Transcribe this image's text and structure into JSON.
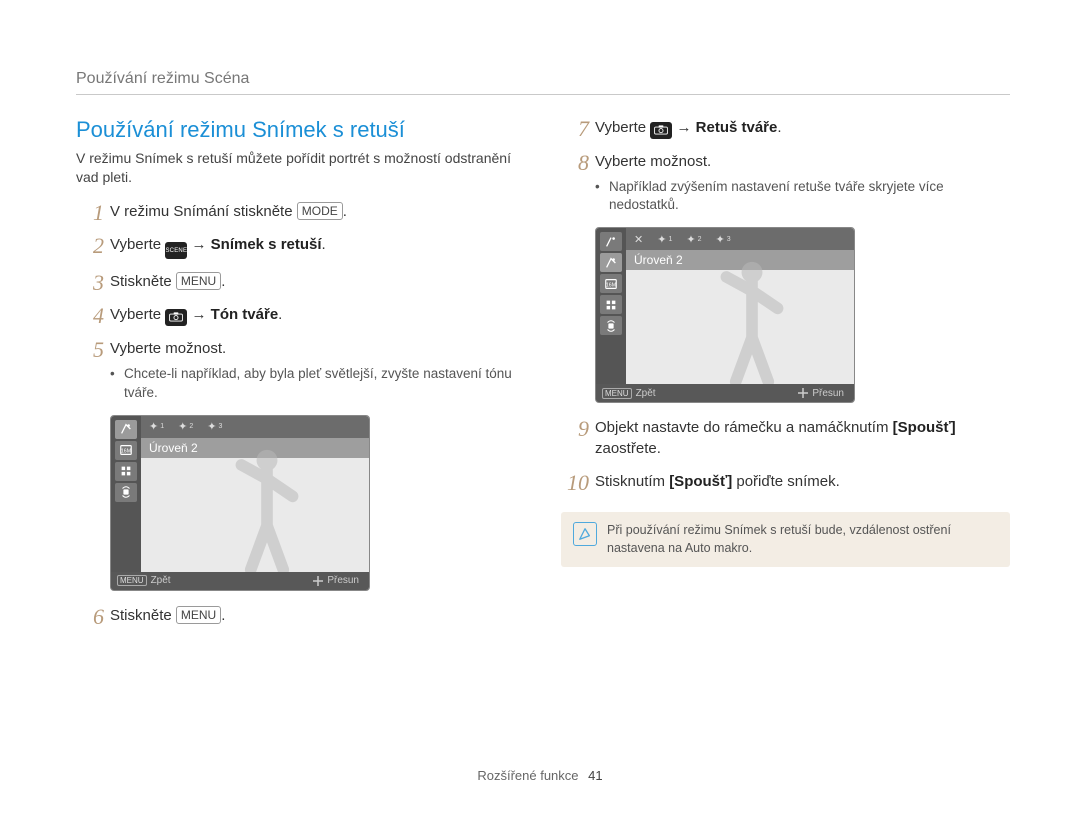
{
  "header": "Používání režimu Scéna",
  "title": "Používání režimu Snímek s retuší",
  "intro": "V režimu Snímek s retuší můžete pořídit portrét s možností odstranění vad pleti.",
  "tags": {
    "mode": "MODE",
    "menu": "MENU",
    "scene": "SCENE"
  },
  "left_steps": {
    "s1_a": "V režimu Snímání stiskněte ",
    "s1_b": ".",
    "s2_a": "Vyberte ",
    "s2_b": " → ",
    "s2_c": "Snímek s retuší",
    "s2_d": ".",
    "s3_a": "Stiskněte ",
    "s3_b": ".",
    "s4_a": "Vyberte ",
    "s4_b": " → ",
    "s4_c": "Tón tváře",
    "s4_d": ".",
    "s5": "Vyberte možnost.",
    "s5_sub": "Chcete-li například, aby byla pleť světlejší, zvyšte nastavení tónu tváře.",
    "s6_a": "Stiskněte ",
    "s6_b": "."
  },
  "right_steps": {
    "s7_a": "Vyberte ",
    "s7_b": " → ",
    "s7_c": "Retuš tváře",
    "s7_d": ".",
    "s8": "Vyberte možnost.",
    "s8_sub": "Například zvýšením nastavení retuše tváře skryjete více nedostatků.",
    "s9_a": "Objekt nastavte do rámečku a namáčknutím ",
    "s9_b": "[Spoušť]",
    "s9_c": " zaostřete.",
    "s10_a": "Stisknutím ",
    "s10_b": "[Spoušť]",
    "s10_c": " pořiďte snímek."
  },
  "shot": {
    "level_label": "Úroveň 2",
    "back": "Zpět",
    "move": "Přesun",
    "res": "16M"
  },
  "icons": {
    "scene": "scene-icon",
    "camera": "camera-icon",
    "note": "note-icon"
  },
  "note": "Při používání režimu Snímek s retuší bude, vzdálenost ostření nastavena na Auto makro.",
  "footer": {
    "section": "Rozšířené funkce",
    "page": "41"
  }
}
